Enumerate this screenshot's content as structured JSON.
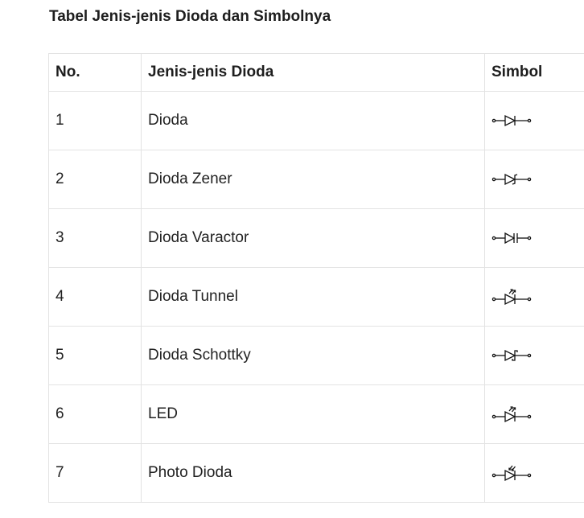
{
  "title": "Tabel Jenis-jenis Dioda dan Simbolnya",
  "table": {
    "headers": {
      "no": "No.",
      "name": "Jenis-jenis Dioda",
      "symbol": "Simbol"
    },
    "rows": [
      {
        "no": "1",
        "name": "Dioda",
        "symbol_icon": "diode-symbol-icon"
      },
      {
        "no": "2",
        "name": "Dioda Zener",
        "symbol_icon": "zener-diode-symbol-icon"
      },
      {
        "no": "3",
        "name": "Dioda Varactor",
        "symbol_icon": "varactor-diode-symbol-icon"
      },
      {
        "no": "4",
        "name": "Dioda Tunnel",
        "symbol_icon": "tunnel-diode-symbol-icon"
      },
      {
        "no": "5",
        "name": "Dioda Schottky",
        "symbol_icon": "schottky-diode-symbol-icon"
      },
      {
        "no": "6",
        "name": "LED",
        "symbol_icon": "led-symbol-icon"
      },
      {
        "no": "7",
        "name": "Photo Dioda",
        "symbol_icon": "photo-diode-symbol-icon"
      }
    ]
  }
}
